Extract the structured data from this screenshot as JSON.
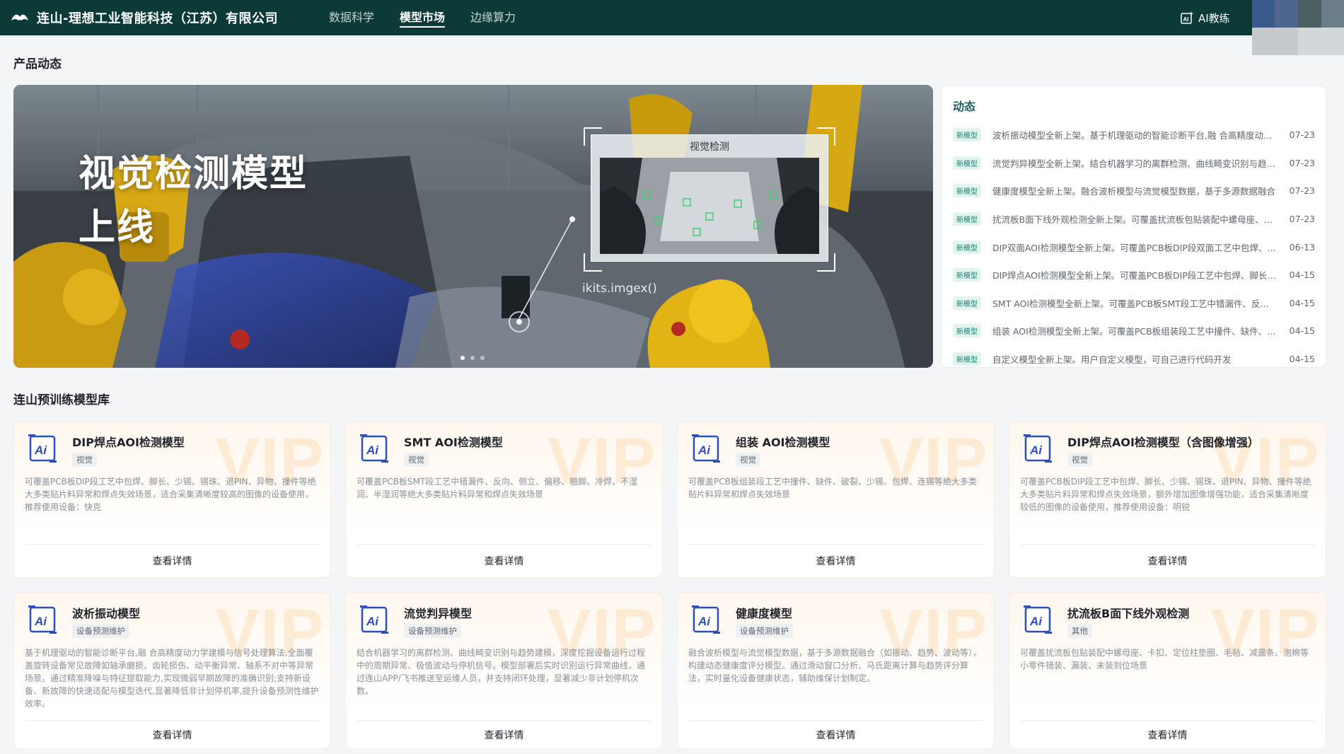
{
  "header": {
    "company": "连山-理想工业智能科技（江苏）有限公司",
    "nav": [
      {
        "label": "数据科学",
        "active": false
      },
      {
        "label": "模型市场",
        "active": true
      },
      {
        "label": "边缘算力",
        "active": false
      }
    ],
    "ai_coach": "AI教练",
    "brand_color": "#0c3a36"
  },
  "product_news": {
    "section_title": "产品动态",
    "banner": {
      "heading_line1": "视觉检测模型",
      "heading_line2": "上线",
      "vision_label": "视觉检测",
      "caption": "ikits.imgex()",
      "slides": 3,
      "active_slide": 1
    },
    "feed": {
      "title": "动态",
      "items": [
        {
          "tag": "新模型",
          "text": "波析振动模型全新上架。基于机理驱动的智能诊断平台,融 合高精度动力学建模与信号处理算法",
          "date": "07-23"
        },
        {
          "tag": "新模型",
          "text": "流觉判异模型全新上架。结合机器学习的离群检测、曲线畸变识别与趋势建模",
          "date": "07-23"
        },
        {
          "tag": "新模型",
          "text": "健康度模型全新上架。融合波析模型与流觉模型数据，基于多源数据融合",
          "date": "07-23"
        },
        {
          "tag": "新模型",
          "text": "扰流板B面下线外观检测全新上架。可覆盖扰流板包贴装配中螺母座、卡扣",
          "date": "07-23"
        },
        {
          "tag": "新模型",
          "text": "DIP双面AOI检测模型全新上架。可覆盖PCB板DIP段双面工艺中包焊、脚长",
          "date": "06-13"
        },
        {
          "tag": "新模型",
          "text": "DIP焊点AOI检测模型全新上架。可覆盖PCB板DIP段工艺中包焊、脚长、少锡",
          "date": "04-15"
        },
        {
          "tag": "新模型",
          "text": "SMT AOI检测模型全新上架。可覆盖PCB板SMT段工艺中错漏件、反向、侧立",
          "date": "04-15"
        },
        {
          "tag": "新模型",
          "text": "组装 AOI检测模型全新上架。可覆盖PCB板组装段工艺中撞件、缺件、破裂",
          "date": "04-15"
        },
        {
          "tag": "新模型",
          "text": "自定义模型全新上架。用户自定义模型，可自己进行代码开发",
          "date": "04-15"
        }
      ]
    }
  },
  "model_library": {
    "section_title": "连山预训练模型库",
    "watermark": "VIP",
    "detail_label": "查看详情",
    "cards": [
      {
        "title": "DIP焊点AOI检测模型",
        "tag": "视觉",
        "desc": "可覆盖PCB板DIP段工艺中包焊、脚长、少锡、锡珠、退PIN、异物、撞件等绝大多类贴片料异常和焊点失效场景，适合采集清晰度较高的图像的设备使用，推荐使用设备：快克"
      },
      {
        "title": "SMT AOI检测模型",
        "tag": "视觉",
        "desc": "可覆盖PCB板SMT段工艺中错漏件、反向、侧立、偏移、翘脚、冷焊、不湿润、半湿润等绝大多类贴片料异常和焊点失效场景"
      },
      {
        "title": "组装 AOI检测模型",
        "tag": "视觉",
        "desc": "可覆盖PCB板组装段工艺中撞件、缺件、破裂、少锡、包焊、连锡等绝大多类贴片料异常和焊点失效场景"
      },
      {
        "title": "DIP焊点AOI检测模型（含图像增强）",
        "tag": "视觉",
        "desc": "可覆盖PCB板DIP段工艺中包焊、脚长、少锡、锡珠、退PIN、异物、撞件等绝大多类贴片料异常和焊点失效场景，额外增加图像增强功能，适合采集清晰度较低的图像的设备使用，推荐使用设备：明锐"
      },
      {
        "title": "波析振动模型",
        "tag": "设备预测维护",
        "desc": "基于机理驱动的智能诊断平台,融 合高精度动力学建模与信号处理算法,全面覆盖旋转设备常见故障如轴承磨损、齿轮损伤、动平衡异常、轴系不对中等异常场景。通过精准降噪与特征提取能力,实现微弱早期故障的准确识别;支持新设备、新故障的快速适配与模型迭代,显著降低非计划停机率,提升设备预测性维护效率。"
      },
      {
        "title": "流觉判异模型",
        "tag": "设备预测维护",
        "desc": "结合机器学习的离群检测、曲线畸变识别与趋势建模，深度挖掘设备运行过程中的周期异常、极值波动与停机信号。模型部署后实时识别运行异常曲线，通过连山APP/飞书推送至运维人员，并支持闭环处理，显著减少非计划停机次数。"
      },
      {
        "title": "健康度模型",
        "tag": "设备预测维护",
        "desc": "融合波析模型与流觉模型数据，基于多源数据融合（如振动、趋势、波动等），构建动态健康度评分模型。通过滑动窗口分析、马氏距离计算与趋势评分算法，实时量化设备健康状态，辅助维保计划制定。"
      },
      {
        "title": "扰流板B面下线外观检测",
        "tag": "其他",
        "desc": "可覆盖扰流板包贴装配中螺母座、卡扣、定位柱垫圈、毛毡、减震条、泡棉等小零件错装、漏装、未装到位场景"
      }
    ]
  }
}
